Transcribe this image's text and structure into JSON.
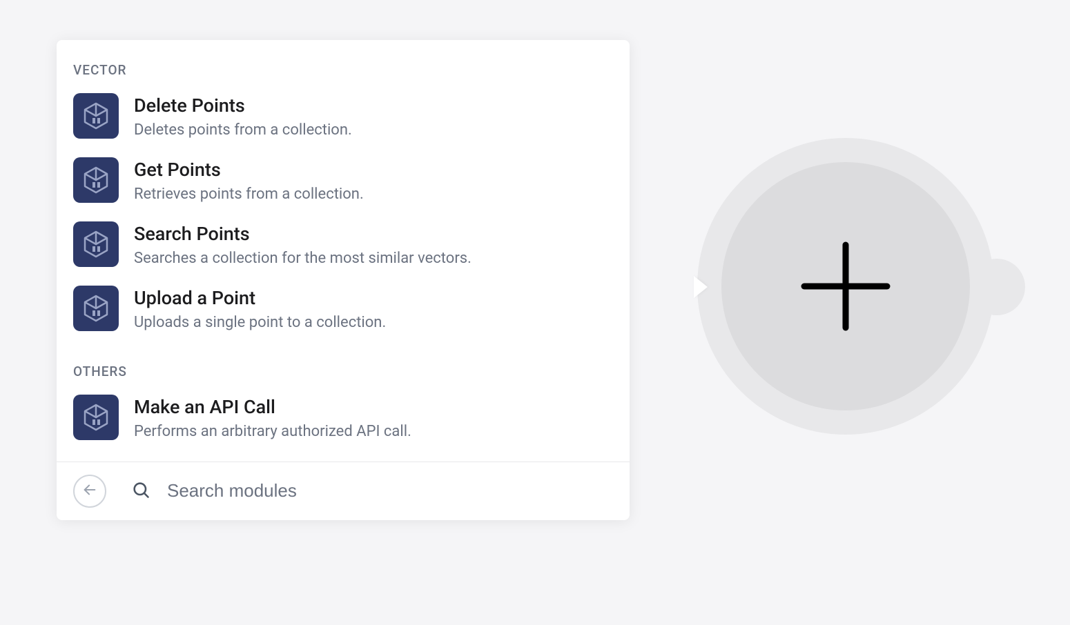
{
  "sections": [
    {
      "header": "VECTOR",
      "items": [
        {
          "id": "delete-points",
          "title": "Delete Points",
          "desc": "Deletes points from a collection."
        },
        {
          "id": "get-points",
          "title": "Get Points",
          "desc": "Retrieves points from a collection."
        },
        {
          "id": "search-points",
          "title": "Search Points",
          "desc": "Searches a collection for the most similar vectors."
        },
        {
          "id": "upload-a-point",
          "title": "Upload a Point",
          "desc": "Uploads a single point to a collection."
        }
      ]
    },
    {
      "header": "OTHERS",
      "items": [
        {
          "id": "make-api-call",
          "title": "Make an API Call",
          "desc": "Performs an arbitrary authorized API call."
        }
      ]
    }
  ],
  "search": {
    "placeholder": "Search modules"
  }
}
